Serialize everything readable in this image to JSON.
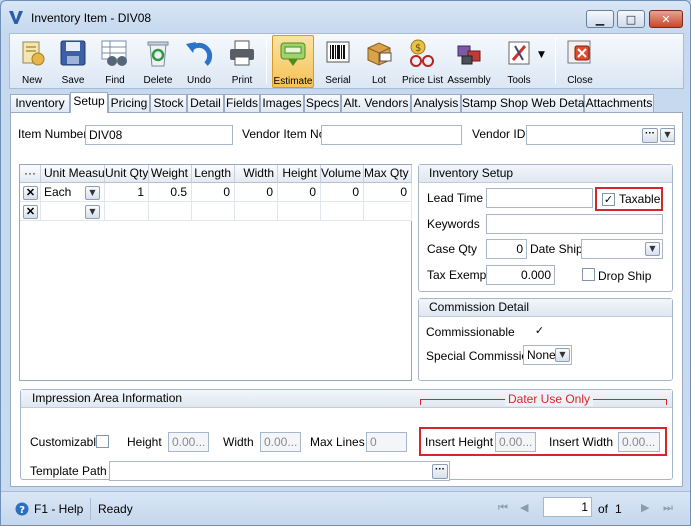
{
  "window": {
    "title": "Inventory Item - DIV08"
  },
  "toolbar": {
    "buttons": [
      {
        "label": "New",
        "icon": "new-icon"
      },
      {
        "label": "Save",
        "icon": "save-icon"
      },
      {
        "label": "Find",
        "icon": "find-icon"
      },
      {
        "label": "Delete",
        "icon": "delete-icon"
      },
      {
        "label": "Undo",
        "icon": "undo-icon"
      },
      {
        "label": "Print",
        "icon": "print-icon"
      },
      {
        "label": "Estimate",
        "icon": "estimate-icon"
      },
      {
        "label": "Serial",
        "icon": "serial-icon"
      },
      {
        "label": "Lot",
        "icon": "lot-icon"
      },
      {
        "label": "Price List",
        "icon": "price-list-icon"
      },
      {
        "label": "Assembly",
        "icon": "assembly-icon"
      },
      {
        "label": "Tools",
        "icon": "tools-icon"
      },
      {
        "label": "Close",
        "icon": "close-icon"
      }
    ],
    "active": "Estimate"
  },
  "tabs": [
    "Inventory",
    "Setup",
    "Pricing",
    "Stock",
    "Detail",
    "Fields",
    "Images",
    "Specs",
    "Alt. Vendors",
    "Analysis",
    "Stamp Shop Web Detail",
    "Attachments"
  ],
  "active_tab": "Setup",
  "item": {
    "item_number_label": "Item Number",
    "item_number": "DIV08",
    "vendor_item_no_label": "Vendor Item No",
    "vendor_item_no": "",
    "vendor_id_label": "Vendor ID",
    "vendor_id": ""
  },
  "grid": {
    "headers": [
      "Unit Measur",
      "Unit Qty",
      "Weight",
      "Length",
      "Width",
      "Height",
      "Volume",
      "Max Qty"
    ],
    "rows": [
      {
        "unit": "Each",
        "unit_qty": "1",
        "weight": "0.5",
        "length": "0",
        "width": "0",
        "height": "0",
        "volume": "0",
        "max_qty": "0"
      },
      {
        "unit": "",
        "unit_qty": "",
        "weight": "",
        "length": "",
        "width": "",
        "height": "",
        "volume": "",
        "max_qty": ""
      }
    ]
  },
  "inventory_setup": {
    "title": "Inventory Setup",
    "lead_time_label": "Lead Time",
    "lead_time": "",
    "taxable_label": "Taxable",
    "taxable": true,
    "keywords_label": "Keywords",
    "keywords": "",
    "case_qty_label": "Case Qty",
    "case_qty": "0",
    "date_ship_label": "Date Ship",
    "date_ship": "",
    "tax_exempt_label": "Tax Exempt",
    "tax_exempt": "0.000",
    "drop_ship_label": "Drop Ship",
    "drop_ship": false
  },
  "commission": {
    "title": "Commission Detail",
    "commissionable_label": "Commissionable",
    "commissionable": true,
    "special_label": "Special Commission",
    "special_value": "None"
  },
  "impression": {
    "title": "Impression Area Information",
    "dater_label": "Dater Use Only",
    "customizable_label": "Customizable",
    "customizable": false,
    "height_label": "Height",
    "height": "0.00...",
    "width_label": "Width",
    "width": "0.00...",
    "max_lines_label": "Max Lines",
    "max_lines": "0",
    "insert_height_label": "Insert Height",
    "insert_height": "0.00...",
    "insert_width_label": "Insert Width",
    "insert_width": "0.00...",
    "template_path_label": "Template Path",
    "template_path": ""
  },
  "status": {
    "help": "F1 - Help",
    "text": "Ready",
    "page": "1",
    "of_label": "of",
    "total": "1"
  },
  "colors": {
    "highlight": "#d5262b",
    "active_button": "#f6c255"
  }
}
